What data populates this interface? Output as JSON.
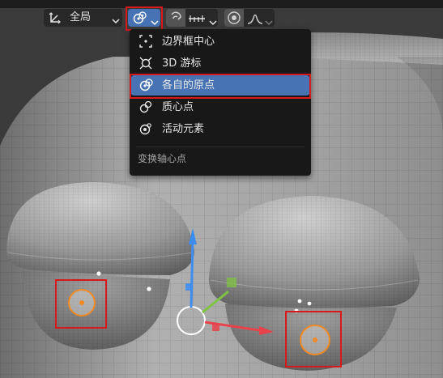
{
  "header": {
    "orientation_label": "全局"
  },
  "pivot_menu": {
    "title": "变换轴心点",
    "items": [
      {
        "label": "边界框中心",
        "icon": "bounding-box-center-icon"
      },
      {
        "label": "3D 游标",
        "icon": "3d-cursor-icon"
      },
      {
        "label": "各自的原点",
        "icon": "individual-origins-icon"
      },
      {
        "label": "质心点",
        "icon": "median-point-icon"
      },
      {
        "label": "活动元素",
        "icon": "active-element-icon"
      }
    ],
    "selected_label": "各自的原点"
  },
  "colors": {
    "accent": "#4772b3",
    "highlight_box": "#d7191c",
    "origin_selected": "#f08a24",
    "gizmo_z": "#3d8cf0",
    "gizmo_y": "#7fc441",
    "gizmo_x": "#e8434b"
  }
}
